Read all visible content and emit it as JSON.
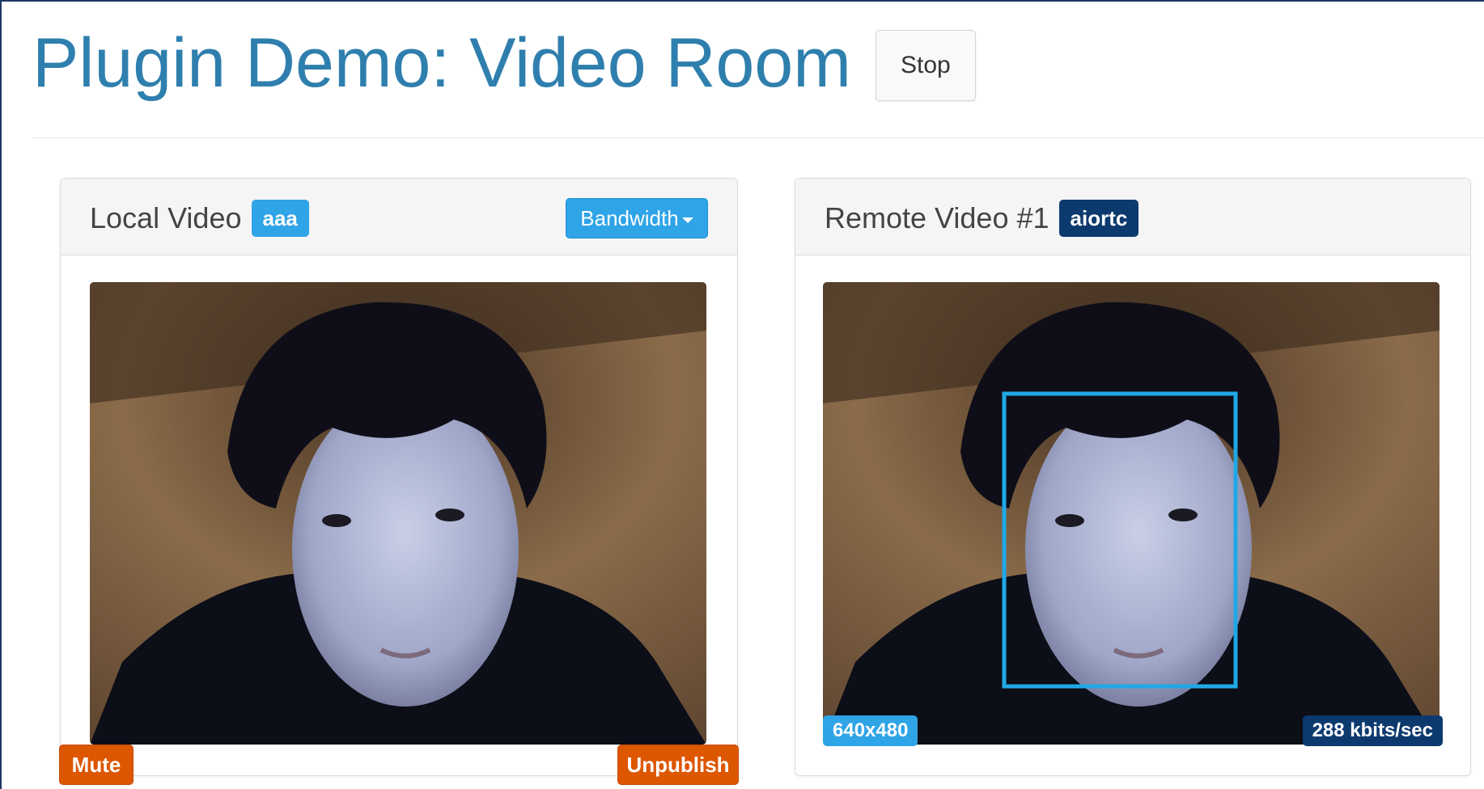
{
  "header": {
    "title": "Plugin Demo: Video Room",
    "stop_label": "Stop"
  },
  "local": {
    "title": "Local Video",
    "user": "aaa",
    "bandwidth_label": "Bandwidth",
    "mute_label": "Mute",
    "unpublish_label": "Unpublish"
  },
  "remote": {
    "title": "Remote Video #1",
    "user": "aiortc",
    "resolution": "640x480",
    "bitrate": "288 kbits/sec",
    "face_box": {
      "present": true,
      "color": "#1fa8e6"
    }
  },
  "colors": {
    "title": "#2f7fae",
    "info": "#2fa4e7",
    "primary": "#0d3a6e",
    "warning": "#dd5600"
  }
}
